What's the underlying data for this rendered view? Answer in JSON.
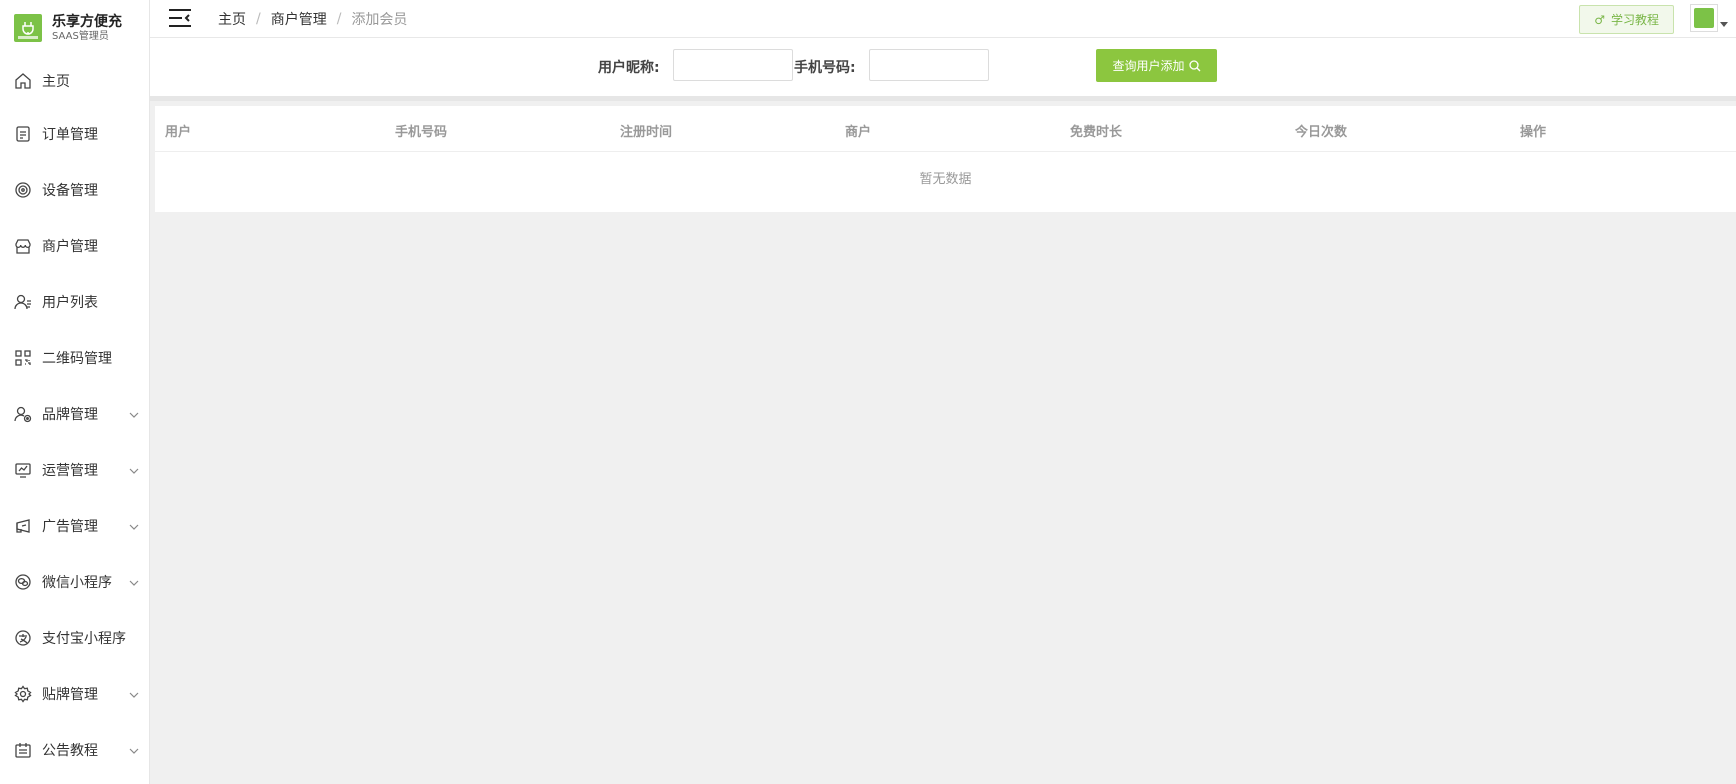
{
  "brand": {
    "title": "乐享方便充",
    "subtitle": "SAAS管理员"
  },
  "sidebar": {
    "items": [
      {
        "label": "主页",
        "icon": "home-icon",
        "expandable": false
      },
      {
        "label": "订单管理",
        "icon": "order-icon",
        "expandable": false
      },
      {
        "label": "设备管理",
        "icon": "device-icon",
        "expandable": false
      },
      {
        "label": "商户管理",
        "icon": "store-icon",
        "expandable": false
      },
      {
        "label": "用户列表",
        "icon": "user-list-icon",
        "expandable": false
      },
      {
        "label": "二维码管理",
        "icon": "qrcode-icon",
        "expandable": false
      },
      {
        "label": "品牌管理",
        "icon": "brand-icon",
        "expandable": true
      },
      {
        "label": "运营管理",
        "icon": "operation-icon",
        "expandable": true
      },
      {
        "label": "广告管理",
        "icon": "ad-icon",
        "expandable": true
      },
      {
        "label": "微信小程序",
        "icon": "wechat-icon",
        "expandable": true
      },
      {
        "label": "支付宝小程序",
        "icon": "alipay-icon",
        "expandable": false
      },
      {
        "label": "贴牌管理",
        "icon": "settings-icon",
        "expandable": true
      },
      {
        "label": "公告教程",
        "icon": "notice-icon",
        "expandable": true
      }
    ]
  },
  "header": {
    "breadcrumb": [
      "主页",
      "商户管理",
      "添加会员"
    ],
    "tutorial_label": "学习教程"
  },
  "search": {
    "nickname_label": "用户昵称:",
    "nickname_value": "",
    "phone_label": "手机号码:",
    "phone_value": "",
    "button_label": "查询用户添加"
  },
  "table": {
    "columns": [
      "用户",
      "手机号码",
      "注册时间",
      "商户",
      "免费时长",
      "今日次数",
      "操作"
    ],
    "empty_text": "暂无数据"
  },
  "colors": {
    "accent": "#8cc63f",
    "logo": "#7cc247"
  }
}
